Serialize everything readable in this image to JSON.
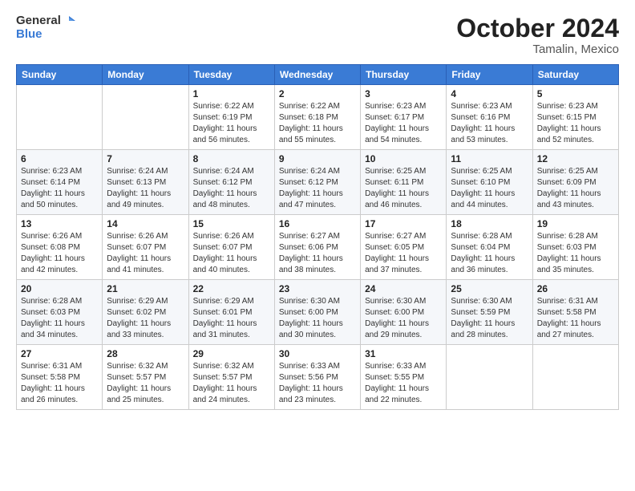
{
  "header": {
    "logo_line1": "General",
    "logo_line2": "Blue",
    "title": "October 2024",
    "subtitle": "Tamalin, Mexico"
  },
  "calendar": {
    "weekdays": [
      "Sunday",
      "Monday",
      "Tuesday",
      "Wednesday",
      "Thursday",
      "Friday",
      "Saturday"
    ],
    "weeks": [
      [
        {
          "day": "",
          "details": ""
        },
        {
          "day": "",
          "details": ""
        },
        {
          "day": "1",
          "details": "Sunrise: 6:22 AM\nSunset: 6:19 PM\nDaylight: 11 hours and 56 minutes."
        },
        {
          "day": "2",
          "details": "Sunrise: 6:22 AM\nSunset: 6:18 PM\nDaylight: 11 hours and 55 minutes."
        },
        {
          "day": "3",
          "details": "Sunrise: 6:23 AM\nSunset: 6:17 PM\nDaylight: 11 hours and 54 minutes."
        },
        {
          "day": "4",
          "details": "Sunrise: 6:23 AM\nSunset: 6:16 PM\nDaylight: 11 hours and 53 minutes."
        },
        {
          "day": "5",
          "details": "Sunrise: 6:23 AM\nSunset: 6:15 PM\nDaylight: 11 hours and 52 minutes."
        }
      ],
      [
        {
          "day": "6",
          "details": "Sunrise: 6:23 AM\nSunset: 6:14 PM\nDaylight: 11 hours and 50 minutes."
        },
        {
          "day": "7",
          "details": "Sunrise: 6:24 AM\nSunset: 6:13 PM\nDaylight: 11 hours and 49 minutes."
        },
        {
          "day": "8",
          "details": "Sunrise: 6:24 AM\nSunset: 6:12 PM\nDaylight: 11 hours and 48 minutes."
        },
        {
          "day": "9",
          "details": "Sunrise: 6:24 AM\nSunset: 6:12 PM\nDaylight: 11 hours and 47 minutes."
        },
        {
          "day": "10",
          "details": "Sunrise: 6:25 AM\nSunset: 6:11 PM\nDaylight: 11 hours and 46 minutes."
        },
        {
          "day": "11",
          "details": "Sunrise: 6:25 AM\nSunset: 6:10 PM\nDaylight: 11 hours and 44 minutes."
        },
        {
          "day": "12",
          "details": "Sunrise: 6:25 AM\nSunset: 6:09 PM\nDaylight: 11 hours and 43 minutes."
        }
      ],
      [
        {
          "day": "13",
          "details": "Sunrise: 6:26 AM\nSunset: 6:08 PM\nDaylight: 11 hours and 42 minutes."
        },
        {
          "day": "14",
          "details": "Sunrise: 6:26 AM\nSunset: 6:07 PM\nDaylight: 11 hours and 41 minutes."
        },
        {
          "day": "15",
          "details": "Sunrise: 6:26 AM\nSunset: 6:07 PM\nDaylight: 11 hours and 40 minutes."
        },
        {
          "day": "16",
          "details": "Sunrise: 6:27 AM\nSunset: 6:06 PM\nDaylight: 11 hours and 38 minutes."
        },
        {
          "day": "17",
          "details": "Sunrise: 6:27 AM\nSunset: 6:05 PM\nDaylight: 11 hours and 37 minutes."
        },
        {
          "day": "18",
          "details": "Sunrise: 6:28 AM\nSunset: 6:04 PM\nDaylight: 11 hours and 36 minutes."
        },
        {
          "day": "19",
          "details": "Sunrise: 6:28 AM\nSunset: 6:03 PM\nDaylight: 11 hours and 35 minutes."
        }
      ],
      [
        {
          "day": "20",
          "details": "Sunrise: 6:28 AM\nSunset: 6:03 PM\nDaylight: 11 hours and 34 minutes."
        },
        {
          "day": "21",
          "details": "Sunrise: 6:29 AM\nSunset: 6:02 PM\nDaylight: 11 hours and 33 minutes."
        },
        {
          "day": "22",
          "details": "Sunrise: 6:29 AM\nSunset: 6:01 PM\nDaylight: 11 hours and 31 minutes."
        },
        {
          "day": "23",
          "details": "Sunrise: 6:30 AM\nSunset: 6:00 PM\nDaylight: 11 hours and 30 minutes."
        },
        {
          "day": "24",
          "details": "Sunrise: 6:30 AM\nSunset: 6:00 PM\nDaylight: 11 hours and 29 minutes."
        },
        {
          "day": "25",
          "details": "Sunrise: 6:30 AM\nSunset: 5:59 PM\nDaylight: 11 hours and 28 minutes."
        },
        {
          "day": "26",
          "details": "Sunrise: 6:31 AM\nSunset: 5:58 PM\nDaylight: 11 hours and 27 minutes."
        }
      ],
      [
        {
          "day": "27",
          "details": "Sunrise: 6:31 AM\nSunset: 5:58 PM\nDaylight: 11 hours and 26 minutes."
        },
        {
          "day": "28",
          "details": "Sunrise: 6:32 AM\nSunset: 5:57 PM\nDaylight: 11 hours and 25 minutes."
        },
        {
          "day": "29",
          "details": "Sunrise: 6:32 AM\nSunset: 5:57 PM\nDaylight: 11 hours and 24 minutes."
        },
        {
          "day": "30",
          "details": "Sunrise: 6:33 AM\nSunset: 5:56 PM\nDaylight: 11 hours and 23 minutes."
        },
        {
          "day": "31",
          "details": "Sunrise: 6:33 AM\nSunset: 5:55 PM\nDaylight: 11 hours and 22 minutes."
        },
        {
          "day": "",
          "details": ""
        },
        {
          "day": "",
          "details": ""
        }
      ]
    ]
  }
}
